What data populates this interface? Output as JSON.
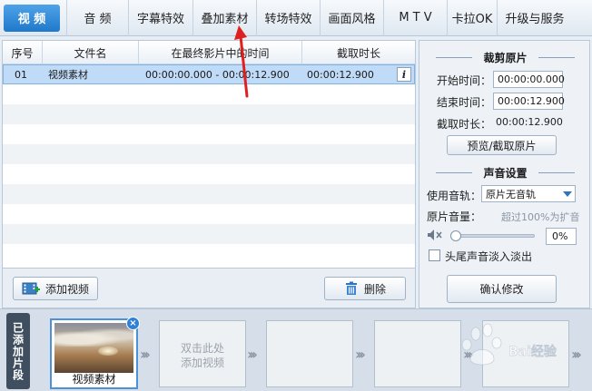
{
  "tabs": [
    {
      "label": "视 频",
      "active": true
    },
    {
      "label": "音 频"
    },
    {
      "label": "字幕特效"
    },
    {
      "label": "叠加素材"
    },
    {
      "label": "转场特效"
    },
    {
      "label": "画面风格"
    },
    {
      "label": "M T V"
    },
    {
      "label": "卡拉OK"
    },
    {
      "label": "升级与服务"
    }
  ],
  "table": {
    "headers": [
      "序号",
      "文件名",
      "在最终影片中的时间",
      "截取时长"
    ],
    "rows": [
      {
        "index": "01",
        "filename": "视频素材",
        "time_range": "00:00:00.000 - 00:00:12.900",
        "duration": "00:00:12.900"
      }
    ],
    "info_icon_glyph": "i"
  },
  "buttons": {
    "add_video": "添加视频",
    "delete": "删除"
  },
  "trim": {
    "title": "裁剪原片",
    "start_label": "开始时间：",
    "start_value": "00:00:00.000",
    "end_label": "结束时间：",
    "end_value": "00:00:12.900",
    "duration_label": "截取时长：",
    "duration_value": "00:00:12.900",
    "preview_button": "预览/截取原片"
  },
  "audio": {
    "title": "声音设置",
    "track_label": "使用音轨：",
    "track_value": "原片无音轨",
    "volume_label": "原片音量：",
    "volume_hint": "超过100%为扩音",
    "volume_value": "0%",
    "volume_level": 0,
    "fade_label": "头尾声音淡入淡出",
    "fade_checked": false,
    "confirm_button": "确认修改"
  },
  "clips": {
    "strip_label": "已添加片段",
    "items": [
      {
        "caption": "视频素材"
      }
    ],
    "add_hint_line1": "双击此处",
    "add_hint_line2": "添加视频",
    "close_glyph": "×"
  },
  "watermark": {
    "text": "Bai经验"
  },
  "colors": {
    "accent": "#2f80d6",
    "selected_row": "#bfdbf8",
    "annotation": "#e02020"
  }
}
